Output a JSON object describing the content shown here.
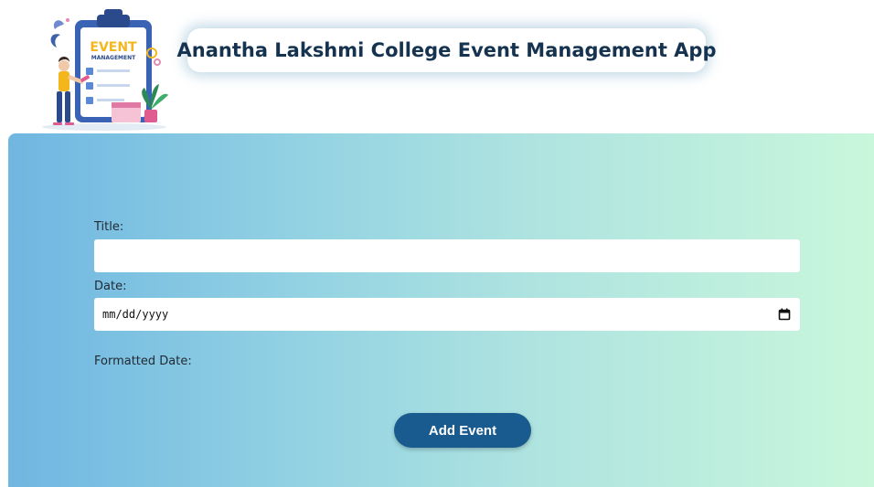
{
  "header": {
    "title": "Anantha Lakshmi College Event Management App",
    "logo": {
      "icon": "event-management-illustration-icon",
      "line1": "EVENT",
      "line2": "MANAGEMENT"
    }
  },
  "form": {
    "title_label": "Title:",
    "title_value": "",
    "date_label": "Date:",
    "date_placeholder": "mm/dd/yyyy",
    "date_icon": "calendar-icon",
    "formatted_date_label": "Formatted Date:",
    "submit_label": "Add Event"
  },
  "colors": {
    "title_text": "#15324f",
    "button_bg": "#1a5b8f",
    "panel_gradient_start": "#6fb6e1",
    "panel_gradient_end": "#c9f7dc"
  }
}
